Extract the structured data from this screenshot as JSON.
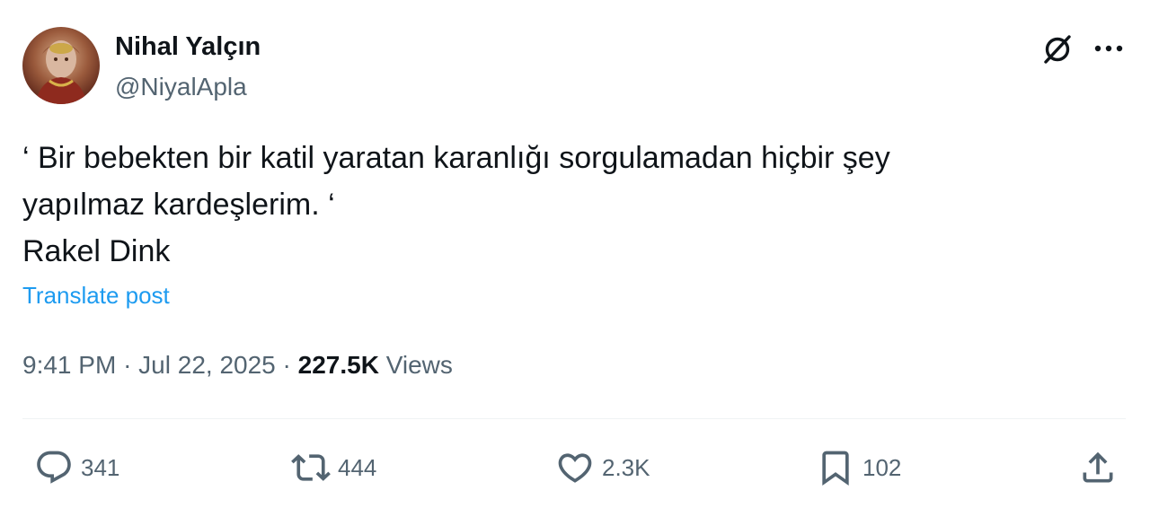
{
  "author": {
    "display_name": "Nihal Yalçın",
    "handle": "@NiyalApla"
  },
  "post": {
    "text_lines": [
      "‘ Bir bebekten bir katil yaratan karanlığı sorgulamadan hiçbir şey",
      "yapılmaz kardeşlerim. ‘",
      "Rakel Dink"
    ],
    "translate_label": "Translate post",
    "time": "9:41 PM",
    "separator": "·",
    "date": "Jul 22, 2025",
    "views_count": "227.5K",
    "views_label": "Views"
  },
  "actions": {
    "replies": "341",
    "reposts": "444",
    "likes": "2.3K",
    "bookmarks": "102"
  },
  "icons": {
    "header": [
      "grok-icon",
      "more-options-icon"
    ],
    "actions": [
      "reply-icon",
      "repost-icon",
      "like-icon",
      "bookmark-icon",
      "share-icon"
    ]
  },
  "colors": {
    "text": "#0f1419",
    "secondary": "#536471",
    "link": "#1d9bf0",
    "divider": "#eff3f4"
  }
}
